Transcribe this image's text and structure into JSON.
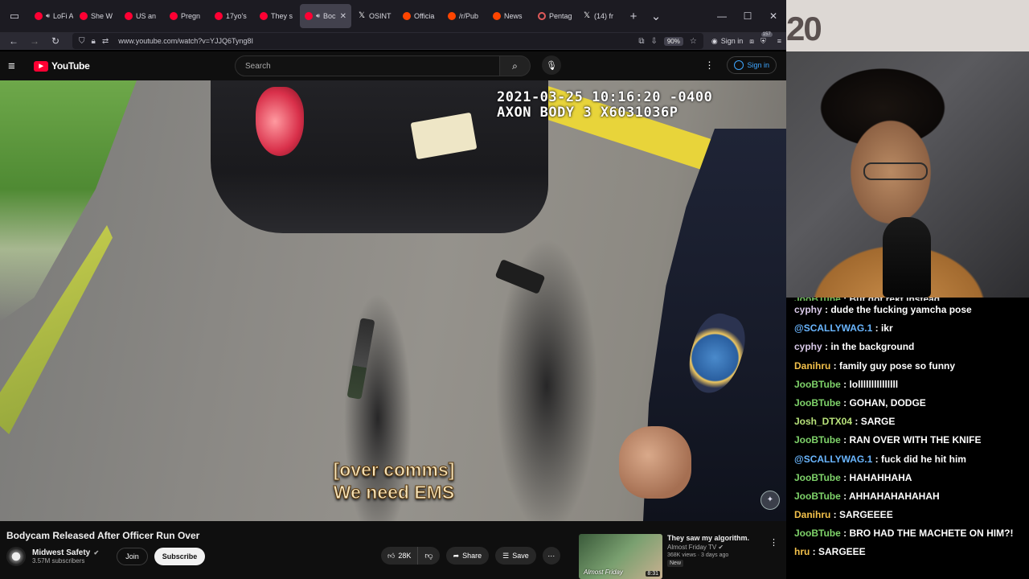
{
  "browser": {
    "tabs": [
      {
        "label": "LoFi A",
        "icon": "yt",
        "audio": true
      },
      {
        "label": "She W",
        "icon": "yt"
      },
      {
        "label": "US an",
        "icon": "yt"
      },
      {
        "label": "Pregn",
        "icon": "yt"
      },
      {
        "label": "17yo's",
        "icon": "yt"
      },
      {
        "label": "They s",
        "icon": "yt"
      },
      {
        "label": "Boc",
        "icon": "yt",
        "audio": true,
        "active": true
      },
      {
        "label": "OSINT",
        "icon": "x"
      },
      {
        "label": "Officia",
        "icon": "reddit"
      },
      {
        "label": "/r/Pub",
        "icon": "reddit"
      },
      {
        "label": "News",
        "icon": "reddit"
      },
      {
        "label": "Pentag",
        "icon": "hollow"
      },
      {
        "label": "(14) fr",
        "icon": "x"
      }
    ],
    "url": "www.youtube.com/watch?v=YJJQ6Tyng8I",
    "zoom": "90%",
    "signin_label": "Sign in",
    "badge_count": "157"
  },
  "youtube": {
    "logo_text": "YouTube",
    "search_placeholder": "Search",
    "signin_label": "Sign in"
  },
  "video": {
    "osd_line1": "2021-03-25 10:16:20 -0400",
    "osd_line2": "AXON BODY 3 X6031036P",
    "subtitle_line1": "[over comms]",
    "subtitle_line2": "We need EMS"
  },
  "info": {
    "title": "Bodycam Released After Officer Run Over",
    "channel_name": "Midwest Safety",
    "subscribers": "3.57M subscribers",
    "join_label": "Join",
    "subscribe_label": "Subscribe",
    "likes": "28K",
    "share_label": "Share",
    "save_label": "Save"
  },
  "recommended": {
    "title": "They saw my algorithm.",
    "channel": "Almost Friday TV",
    "meta": "368K views · 3 days ago",
    "new_badge": "New",
    "duration": "8:31",
    "thumb_text": "Almost Friday"
  },
  "stream": {
    "overlay_number": "20",
    "chat": [
      {
        "user": "JooBTube",
        "color": "#7fd36a",
        "text": " : But got rekt instead."
      },
      {
        "user": "cyphy",
        "color": "#d9c9e8",
        "text": " : dude the fucking yamcha pose"
      },
      {
        "user": "@SCALLYWAG.1",
        "color": "#6ab6ff",
        "text": " : ikr"
      },
      {
        "user": "cyphy",
        "color": "#d9c9e8",
        "text": " : in the background"
      },
      {
        "user": "Danihru",
        "color": "#f3c14b",
        "text": " : family guy pose so funny"
      },
      {
        "user": "JooBTube",
        "color": "#7fd36a",
        "text": " : lolllllllllllllll"
      },
      {
        "user": "JooBTube",
        "color": "#7fd36a",
        "text": " : GOHAN, DODGE"
      },
      {
        "user": "Josh_DTX04",
        "color": "#b8e27a",
        "text": " : SARGE"
      },
      {
        "user": "JooBTube",
        "color": "#7fd36a",
        "text": " : RAN OVER WITH THE KNIFE"
      },
      {
        "user": "@SCALLYWAG.1",
        "color": "#6ab6ff",
        "text": " : fuck did he hit him"
      },
      {
        "user": "JooBTube",
        "color": "#7fd36a",
        "text": " : HAHAHHAHA"
      },
      {
        "user": "JooBTube",
        "color": "#7fd36a",
        "text": " : AHHAHAHAHAHAH"
      },
      {
        "user": "Danihru",
        "color": "#f3c14b",
        "text": " : SARGEEEE"
      },
      {
        "user": "JooBTube",
        "color": "#7fd36a",
        "text": " : BRO HAD THE MACHETE ON HIM?!"
      },
      {
        "user": "hru",
        "color": "#f3c14b",
        "text": " : SARGEEE"
      }
    ]
  }
}
